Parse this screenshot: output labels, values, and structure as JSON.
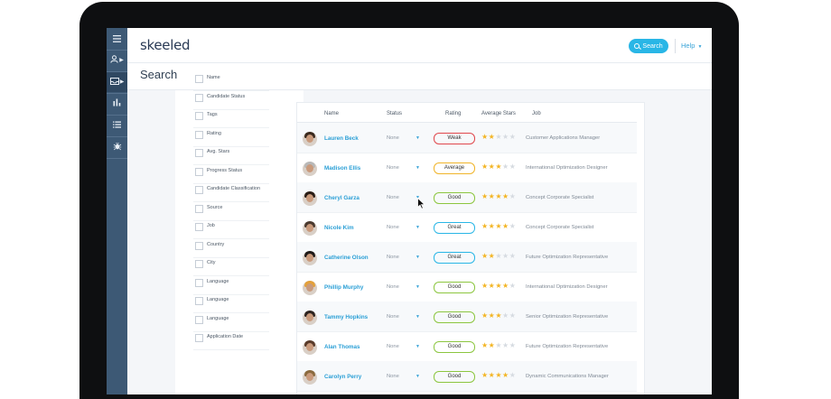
{
  "app": {
    "logo": "skeeled",
    "page_title": "Search"
  },
  "header": {
    "search_label": "Search",
    "help_label": "Help"
  },
  "rail": {
    "icons": [
      "menu-icon",
      "user-icon",
      "inbox-icon",
      "bar-chart-icon",
      "list-icon",
      "bug-icon"
    ]
  },
  "filters": [
    "Name",
    "Candidate Status",
    "Tags",
    "Rating",
    "Avg. Stars",
    "Progress Status",
    "Candidate Classification",
    "Source",
    "Job",
    "Country",
    "City",
    "Language",
    "Language",
    "Language",
    "Application Date"
  ],
  "table": {
    "headers": {
      "name": "Name",
      "status": "Status",
      "rating": "Rating",
      "avg_stars": "Average Stars",
      "job": "Job"
    },
    "rows": [
      {
        "name": "Lauren Beck",
        "status": "None",
        "rating": "Weak",
        "rating_color": "#e0474c",
        "stars": 2,
        "job": "Customer Applications Manager",
        "hair": "#3a2a1e"
      },
      {
        "name": "Madison Ellis",
        "status": "None",
        "rating": "Average",
        "rating_color": "#f0b429",
        "stars": 3,
        "job": "International Optimization Designer",
        "hair": "#b8b8b8"
      },
      {
        "name": "Cheryl Garza",
        "status": "None",
        "rating": "Good",
        "rating_color": "#8cc63f",
        "stars": 4,
        "job": "Concept Corporate Specialist",
        "hair": "#2a1d16"
      },
      {
        "name": "Nicole Kim",
        "status": "None",
        "rating": "Great",
        "rating_color": "#29b6e6",
        "stars": 4,
        "job": "Concept Corporate Specialist",
        "hair": "#4b3a2f"
      },
      {
        "name": "Catherine Olson",
        "status": "None",
        "rating": "Great",
        "rating_color": "#29b6e6",
        "stars": 2,
        "job": "Future Optimization Representative",
        "hair": "#1f1a18"
      },
      {
        "name": "Phillip Murphy",
        "status": "None",
        "rating": "Good",
        "rating_color": "#8cc63f",
        "stars": 4,
        "job": "International Optimization Designer",
        "hair": "#e3a03a"
      },
      {
        "name": "Tammy Hopkins",
        "status": "None",
        "rating": "Good",
        "rating_color": "#8cc63f",
        "stars": 3,
        "job": "Senior Optimization Representative",
        "hair": "#2e2420"
      },
      {
        "name": "Alan Thomas",
        "status": "None",
        "rating": "Good",
        "rating_color": "#8cc63f",
        "stars": 2,
        "job": "Future Optimization Representative",
        "hair": "#5a3b2a"
      },
      {
        "name": "Carolyn Perry",
        "status": "None",
        "rating": "Good",
        "rating_color": "#8cc63f",
        "stars": 4,
        "job": "Dynamic Communications Manager",
        "hair": "#8a6a3e"
      }
    ]
  }
}
